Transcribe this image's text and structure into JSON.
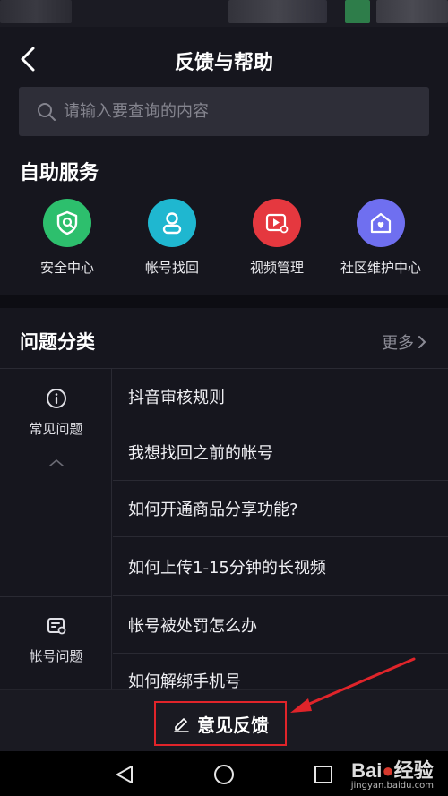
{
  "header": {
    "title": "反馈与帮助"
  },
  "search": {
    "placeholder": "请输入要查询的内容"
  },
  "self_service": {
    "title": "自助服务",
    "items": [
      {
        "label": "安全中心",
        "icon": "shield-icon",
        "color": "#2dbf6d"
      },
      {
        "label": "帐号找回",
        "icon": "user-icon",
        "color": "#1fb7d0"
      },
      {
        "label": "视频管理",
        "icon": "video-settings-icon",
        "color": "#e5383f"
      },
      {
        "label": "社区维护中心",
        "icon": "home-heart-icon",
        "color": "#6f6ff0"
      }
    ]
  },
  "categories": {
    "title": "问题分类",
    "more_label": "更多",
    "groups": [
      {
        "label": "常见问题",
        "icon": "info-icon"
      },
      {
        "label": "帐号问题",
        "icon": "account-card-icon"
      }
    ],
    "questions": [
      "抖音审核规则",
      "我想找回之前的帐号",
      "如何开通商品分享功能?",
      "如何上传1-15分钟的长视频",
      "帐号被处罚怎么办",
      "如何解绑手机号"
    ]
  },
  "feedback": {
    "label": "意见反馈"
  },
  "watermark": {
    "brand": "Bai",
    "brand_end": "经验",
    "sub": "jingyan.baidu.com"
  },
  "colors": {
    "background": "#16161e",
    "accent_red": "#e0242a"
  }
}
